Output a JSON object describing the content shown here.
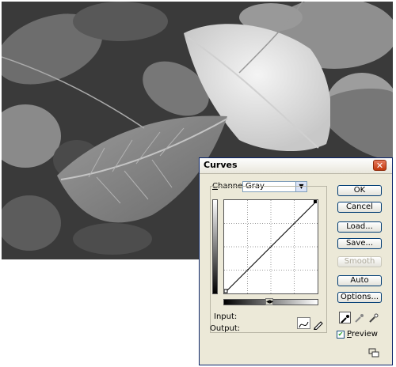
{
  "dialog": {
    "title": "Curves",
    "close_label": "✕",
    "channel_label_prefix": "C",
    "channel_label_rest": "hannel:",
    "channel_value": "Gray",
    "input_label": "Input:",
    "output_label": "Output:",
    "buttons": {
      "ok": "OK",
      "cancel": "Cancel",
      "load": "Load...",
      "save": "Save...",
      "smooth": "Smooth",
      "auto": "Auto",
      "options": "Options..."
    },
    "preview_label_prefix": "P",
    "preview_label_rest": "review",
    "preview_checked": true,
    "curve": {
      "points": [
        [
          0,
          0
        ],
        [
          255,
          255
        ]
      ]
    }
  },
  "icons": {
    "close": "close-icon",
    "dropdown": "chevron-down-icon",
    "curve_tool": "curve-icon",
    "pencil_tool": "pencil-icon",
    "eyedropper_black": "black-eyedropper-icon",
    "eyedropper_gray": "gray-eyedropper-icon",
    "eyedropper_white": "white-eyedropper-icon",
    "toggle": "gradient-toggle-icon",
    "resize": "resize-icon"
  },
  "colors": {
    "title_bar": "#0a246a",
    "dialog_bg": "#ece9d8",
    "close_button": "#c1380d"
  }
}
